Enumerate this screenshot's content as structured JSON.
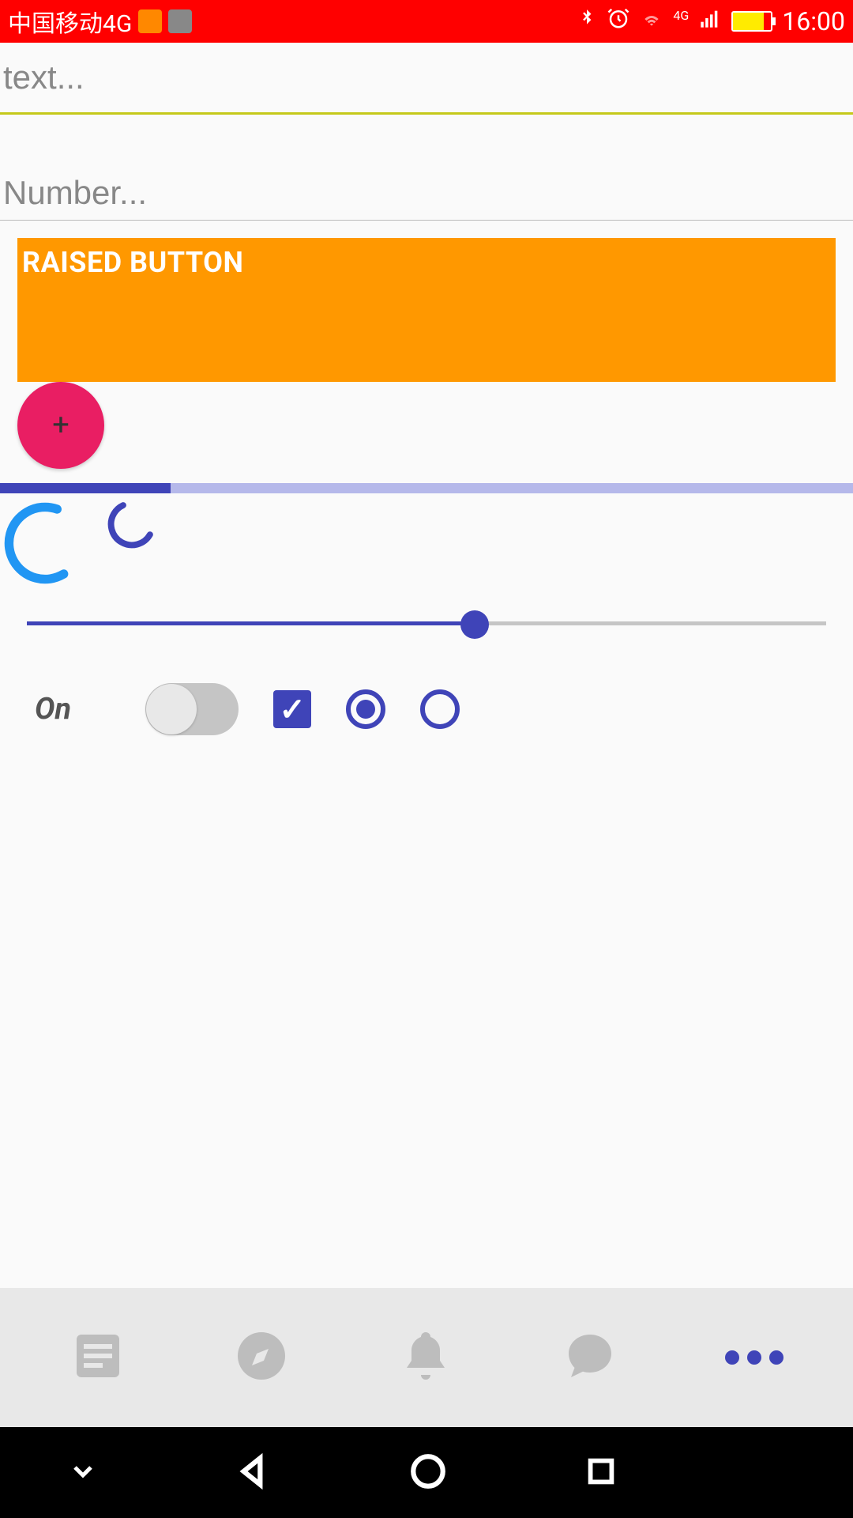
{
  "status_bar": {
    "carrier": "中国移动4G",
    "time": "16:00",
    "network_label": "4G"
  },
  "inputs": {
    "text_placeholder": "text...",
    "text_value": "",
    "number_placeholder": "Number...",
    "number_value": ""
  },
  "raised_button": {
    "label": "RAISED BUTTON",
    "bg_color": "#ff9800"
  },
  "fab": {
    "label": "+",
    "bg_color": "#e91e63"
  },
  "progress": {
    "linear_percent": 20,
    "slider_percent": 56
  },
  "controls": {
    "switch_label": "On",
    "switch_value": false,
    "checkbox_value": true,
    "radio_selected_index": 0
  },
  "colors": {
    "accent": "#3f44b8",
    "orange": "#ff9800",
    "pink": "#e91e63",
    "status_bg": "#ff0000"
  }
}
